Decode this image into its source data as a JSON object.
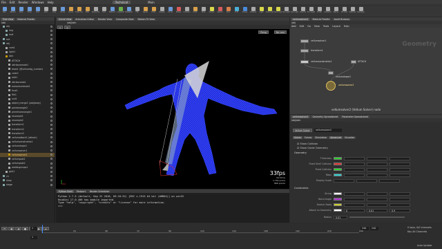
{
  "menubar": {
    "items": [
      "File",
      "Edit",
      "Render",
      "Windows",
      "Help"
    ],
    "desktop": "Technical",
    "build": "Main"
  },
  "shelf": {
    "tools": [
      {
        "label": "Box",
        "color": "#6a9ad8"
      },
      {
        "label": "Sphere",
        "color": "#6a9ad8"
      },
      {
        "label": "Tube",
        "color": "#6a9ad8"
      },
      {
        "label": "Torus",
        "color": "#6a9ad8"
      },
      {
        "label": "Grid",
        "color": "#6a9ad8"
      },
      {
        "label": "Null",
        "color": "#aaa"
      },
      {
        "label": "Line",
        "color": "#aaa"
      },
      {
        "label": "Circle",
        "color": "#6a9ad8"
      },
      {
        "label": "Curve",
        "color": "#d8a04a"
      },
      {
        "label": "Draw Curve",
        "color": "#d8a04a"
      },
      {
        "label": "Path",
        "color": "#d8a04a"
      },
      {
        "label": "Spray Paint",
        "color": "#aaa"
      },
      {
        "label": "Font",
        "color": "#aaa"
      },
      {
        "label": "Platonic",
        "color": "#6a9ad8"
      },
      {
        "label": "L-System",
        "color": "#6ab04a"
      },
      {
        "label": "Metaball",
        "color": "#6a9ad8"
      },
      {
        "label": "File",
        "color": "#aaa"
      },
      {
        "label": "Spiral",
        "color": "#d8a04a"
      },
      {
        "label": "Helix",
        "color": "#d8a04a"
      },
      {
        "label": "Sweep",
        "color": "#aaa"
      },
      {
        "label": "Circle",
        "color": "#6a9ad8"
      },
      {
        "label": "Ropes",
        "color": "#d85a5a"
      },
      {
        "label": "Collision",
        "color": "#aaa"
      },
      {
        "label": "Cloth",
        "color": "#d8a04a"
      },
      {
        "label": "Wire",
        "color": "#aaa"
      },
      {
        "label": "Grains",
        "color": "#d8d84a"
      },
      {
        "label": "Vellum",
        "color": "#d85a5a"
      },
      {
        "label": "Pyro",
        "color": "#d8804a"
      },
      {
        "label": "FLIP",
        "color": "#4ab0d8"
      },
      {
        "label": "Ocean",
        "color": "#4a8ad8"
      },
      {
        "label": "Camera",
        "color": "#aaa"
      },
      {
        "label": "Light",
        "color": "#d8d84a"
      },
      {
        "label": "Area Light",
        "color": "#d8d84a"
      },
      {
        "label": "Spot Light",
        "color": "#d8d84a"
      },
      {
        "label": "Sky Light",
        "color": "#aaa"
      },
      {
        "label": "Geo Light",
        "color": "#aaa"
      },
      {
        "label": "Volume",
        "color": "#aaa"
      },
      {
        "label": "Env Light",
        "color": "#aaa"
      },
      {
        "label": "Portal",
        "color": "#aaa"
      },
      {
        "label": "Ambient",
        "color": "#aaa"
      },
      {
        "label": "Stereo",
        "color": "#aaa"
      },
      {
        "label": "VR Cam",
        "color": "#aaa"
      },
      {
        "label": "Switcher",
        "color": "#aaa"
      },
      {
        "label": "Gamepad",
        "color": "#aaa"
      }
    ]
  },
  "tree": {
    "tabs": [
      "Tree View",
      "Material Palette"
    ],
    "path": "/obj",
    "rows": [
      {
        "label": "obj",
        "indent": 1,
        "color": "#8aa"
      },
      {
        "label": "img",
        "indent": 2,
        "color": "#8aa"
      },
      {
        "label": "mat",
        "indent": 2,
        "color": "#8aa"
      },
      {
        "label": "out",
        "indent": 1,
        "color": "#8aa"
      },
      {
        "label": "obj",
        "indent": 1,
        "color": "#8aa"
      },
      {
        "label": "cam1",
        "indent": 2,
        "color": "#aaa"
      },
      {
        "label": "light1",
        "indent": 2,
        "color": "#aaa"
      },
      {
        "label": "skin",
        "indent": 2,
        "color": "#c90"
      },
      {
        "label": "ATTACH",
        "indent": 3,
        "color": "#aaa"
      },
      {
        "label": "attribpromote1",
        "indent": 3,
        "color": "#aaa"
      },
      {
        "label": "blast1 (@vellumbg_number)",
        "indent": 3,
        "color": "#aaa"
      },
      {
        "label": "color1",
        "indent": 3,
        "color": "#aaa"
      },
      {
        "label": "edit1",
        "indent": 3,
        "color": "#aaa"
      },
      {
        "label": "attribcreate1",
        "indent": 3,
        "color": "#aaa"
      },
      {
        "label": "extractcentroid1",
        "indent": 3,
        "color": "#aaa"
      },
      {
        "label": "fuse1",
        "indent": 3,
        "color": "#aaa"
      },
      {
        "label": "file1",
        "indent": 3,
        "color": "#aaa"
      },
      {
        "label": "null1",
        "indent": 3,
        "color": "#aaa"
      },
      {
        "label": "object_merge1 (/obj/body)",
        "indent": 3,
        "color": "#aaa"
      },
      {
        "label": "pointwrangle2",
        "indent": 3,
        "color": "#aaa"
      },
      {
        "label": "primitivewrangle1",
        "indent": 3,
        "color": "#aaa"
      },
      {
        "label": "resample1",
        "indent": 3,
        "color": "#aaa"
      },
      {
        "label": "resample2",
        "indent": 3,
        "color": "#aaa"
      },
      {
        "label": "transform1",
        "indent": 3,
        "color": "#aaa"
      },
      {
        "label": "transform2",
        "indent": 3,
        "color": "#aaa"
      },
      {
        "label": "transform3",
        "indent": 3,
        "color": "#aaa"
      },
      {
        "label": "vellumattach1 (attach)",
        "indent": 3,
        "color": "#aaa"
      },
      {
        "label": "vellumconstraints1",
        "indent": 3,
        "color": "#aaa"
      },
      {
        "label": "vellumdrape1",
        "indent": 3,
        "color": "#aaa"
      },
      {
        "label": "vellumsolver1",
        "indent": 3,
        "color": "#aaa"
      },
      {
        "label": "vellumsolver2",
        "indent": 3,
        "color": "#c90",
        "hl": true
      },
      {
        "label": "vellumpost1",
        "indent": 3,
        "color": "#aaa"
      },
      {
        "label": "vellumpost2",
        "indent": 3,
        "color": "#aaa"
      },
      {
        "label": "weldingroups1",
        "indent": 3,
        "color": "#aaa"
      },
      {
        "label": "grid1",
        "indent": 2,
        "color": "#aaa"
      },
      {
        "label": "ch",
        "indent": 1,
        "color": "#8aa"
      },
      {
        "label": "shop",
        "indent": 1,
        "color": "#8aa"
      },
      {
        "label": "stage",
        "indent": 1,
        "color": "#8aa"
      }
    ]
  },
  "viewer": {
    "tabs": [
      "Scene View",
      "Animation Editor",
      "Render View",
      "Composite View",
      "Motion FX View"
    ],
    "path": "/obj/skin",
    "persp": "Persp",
    "cam": "No cam",
    "fps": "33fps",
    "fps_ms": "30.57ms",
    "stats": [
      "1,754 prims",
      "868 points"
    ]
  },
  "console": {
    "tabs": [
      "Python Shell",
      "Textport",
      "Render Scheduler"
    ],
    "lines": [
      "Python 2.7.5 (default, Sep 22 2018, 09:18:32) [MSC v.1915 64 bit (AMD64)] on win32",
      "Houdini 17.0.406 hou module imported.",
      "Type \"help\", \"copyright\", \"credits\" or \"license\" for more information.",
      ">>>"
    ]
  },
  "network": {
    "tabs": [
      "vellumsolver2",
      "Material Palette",
      "Asset Browser"
    ],
    "path": "/obj",
    "menus": [
      "Add",
      "Edit",
      "Go",
      "View",
      "Tools",
      "Layout",
      "Help"
    ],
    "watermark": "Geometry",
    "nodes": [
      "vellumsolver1",
      "transform1",
      "vellumconstraints1",
      "ATTACH",
      "vellumdrape1",
      "vellumsolver2"
    ],
    "caption": "vellumsolver2 (Vellum Solver) node"
  },
  "parms": {
    "tabs": [
      "vellumsolver2",
      "Geometry Spreadsheet",
      "Parameter Spreadsheet"
    ],
    "path": "/obj/skin",
    "node_type": "Vellum Solver",
    "node_name": "vellumsolver2",
    "subtabs": [
      "Solver",
      "Forces",
      "Simulation",
      "Advanced",
      "Visualize"
    ],
    "checks": [
      "Show Collision",
      "Show Guide Geometry"
    ],
    "section1": "Geometry",
    "geo_parms": [
      {
        "label": "Thickness",
        "color": "#2fd02f"
      },
      {
        "label": "Fixed Shell Collision",
        "color": "#e03030"
      },
      {
        "label": "Fixed Collision",
        "color": "#2fd02f"
      },
      {
        "label": "Mass",
        "color": "#2fd0d0"
      },
      {
        "label": "Display Scale",
        "color": ""
      }
    ],
    "section2": "Constraints",
    "con_parms": [
      {
        "label": "String",
        "color": "#ffffff"
      },
      {
        "label": "Bend Angle",
        "color": "#b02fd0"
      },
      {
        "label": "Stretch Ratio",
        "color": "#d0d02f"
      },
      {
        "label": "Attach to Geometry",
        "color": "#ffffff"
      }
    ],
    "attach_values": [
      "0",
      "0.01",
      "0.9"
    ],
    "radius_label": "Radius",
    "radius_value": "0.01"
  },
  "timeline": {
    "frame": "1",
    "start": "1",
    "end": "240",
    "ticks": [
      "1",
      "24",
      "48",
      "72",
      "96",
      "120",
      "144",
      "168",
      "192",
      "216",
      "240"
    ],
    "keys_label": "0 keys, 0/0 channels",
    "key_all": "Key All Channels",
    "auto_update": "Auto Update"
  }
}
